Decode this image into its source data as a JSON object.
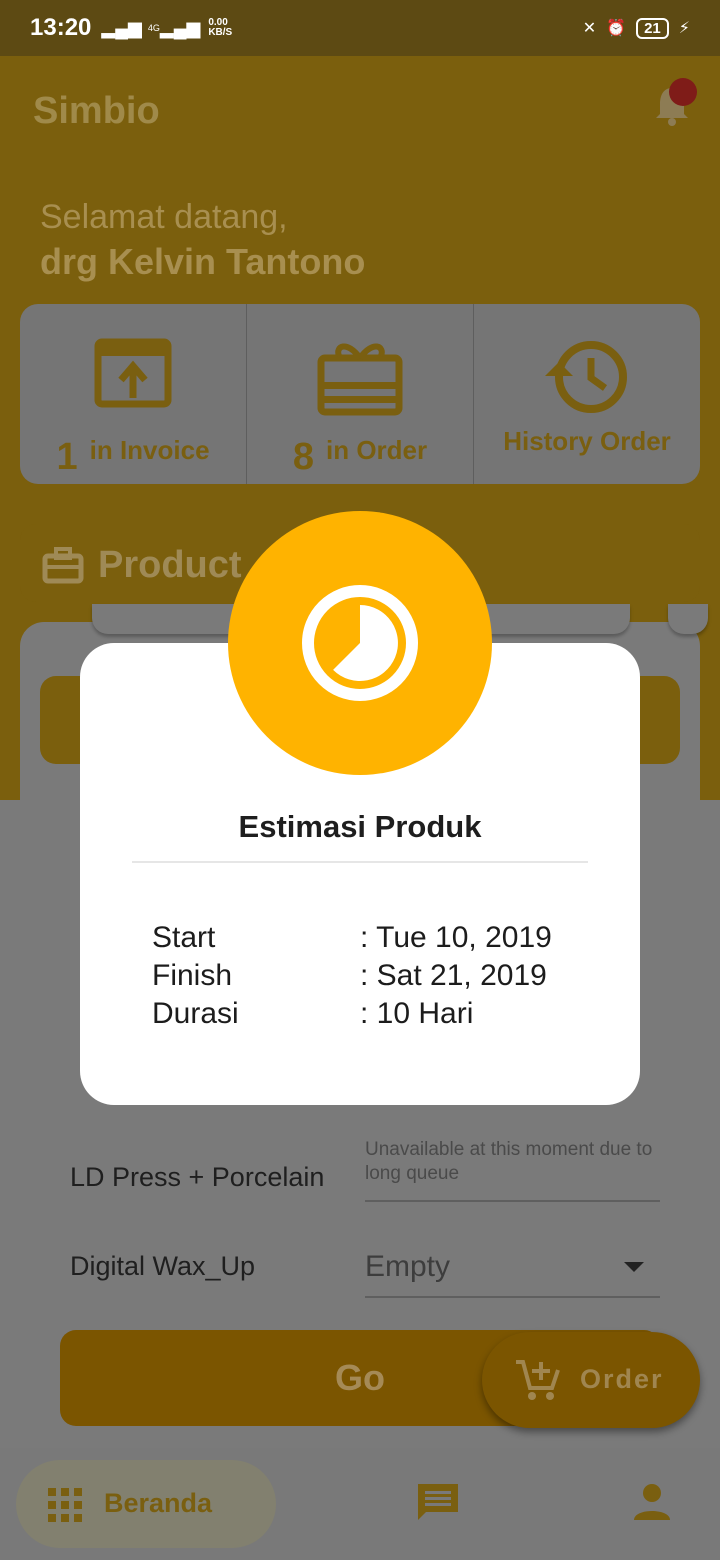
{
  "status_bar": {
    "time": "13:20",
    "net_speed": "0.00",
    "net_unit": "KB/S",
    "network": "4G",
    "battery": "21"
  },
  "app": {
    "title": "Simbio"
  },
  "greeting": {
    "line1": "Selamat datang,",
    "name": "drg Kelvin Tantono"
  },
  "stats": [
    {
      "count": "1",
      "label": "in Invoice",
      "icon": "upload-box-icon"
    },
    {
      "count": "8",
      "label": "in Order",
      "icon": "gift-icon"
    },
    {
      "count": "",
      "label": "History Order",
      "icon": "history-icon"
    }
  ],
  "product": {
    "label": "Product"
  },
  "form": {
    "rows": [
      {
        "label": "LD Press + Porcelain",
        "note": "Unavailable at this moment due to long queue"
      },
      {
        "label": "Digital Wax_Up",
        "value": "Empty"
      }
    ]
  },
  "actions": {
    "go_label": "Go",
    "order_label": "Order"
  },
  "bottom_nav": {
    "home_label": "Beranda"
  },
  "modal": {
    "title": "Estimasi Produk",
    "rows": [
      {
        "key": "Start",
        "value": ": Tue 10, 2019"
      },
      {
        "key": "Finish",
        "value": ": Sat 21, 2019"
      },
      {
        "key": "Durasi",
        "value": ": 10 Hari"
      }
    ]
  },
  "colors": {
    "accent": "#ffb300",
    "dim_accent": "#7b5f0d"
  }
}
